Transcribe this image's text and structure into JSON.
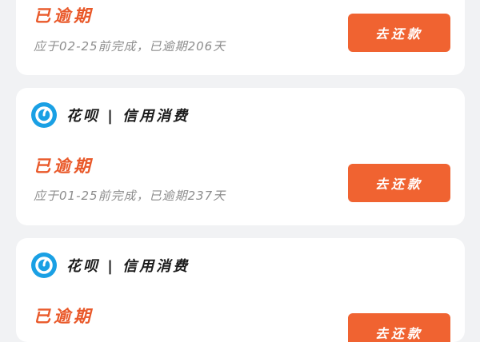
{
  "cards": [
    {
      "status": "已逾期",
      "desc": "应于02-25前完成，已逾期206天",
      "button_label": "去还款"
    },
    {
      "brand": "花呗 | 信用消费",
      "status": "已逾期",
      "desc": "应于01-25前完成，已逾期237天",
      "button_label": "去还款"
    },
    {
      "brand": "花呗 | 信用消费",
      "status": "已逾期",
      "button_label": "去还款"
    }
  ],
  "colors": {
    "accent": "#f06331",
    "status_text": "#e9592a",
    "logo": "#1aa0e4",
    "background": "#f1f2f4"
  },
  "icons": {
    "brand_logo": "huabei-logo-icon"
  }
}
